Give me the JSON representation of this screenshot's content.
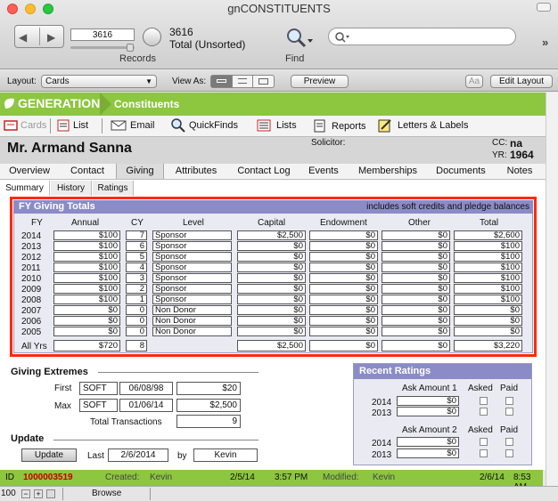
{
  "window": {
    "title": "gnCONSTITUENTS"
  },
  "toolbar": {
    "record_value": "3616",
    "found_count": "3616",
    "total_label": "Total (Unsorted)",
    "records_label": "Records",
    "find_label": "Find"
  },
  "layoutbar": {
    "layout_label": "Layout:",
    "layout_value": "Cards",
    "viewas_label": "View As:",
    "preview_label": "Preview",
    "aa_label": "Aa",
    "edit_layout_label": "Edit Layout"
  },
  "brand": {
    "name": "GENERATIONS",
    "section": "Constituents"
  },
  "nav": {
    "items": [
      "Cards",
      "List",
      "Email",
      "QuickFinds",
      "Lists",
      "Reports",
      "Letters & Labels"
    ]
  },
  "header": {
    "name": "Mr. Armand Sanna",
    "solicitor_label": "Solicitor:",
    "cc_label": "CC:",
    "cc_value": "na",
    "yr_label": "YR:",
    "yr_value": "1964"
  },
  "tabs": [
    "Overview",
    "Contact",
    "Giving",
    "Attributes",
    "Contact Log",
    "Events",
    "Memberships",
    "Documents",
    "Notes"
  ],
  "subtabs": [
    "Summary",
    "History",
    "Ratings"
  ],
  "fy": {
    "title": "FY Giving Totals",
    "note": "includes soft credits and pledge balances",
    "columns": [
      "FY",
      "Annual",
      "CY",
      "Level",
      "Capital",
      "Endowment",
      "Other",
      "Total"
    ],
    "rows": [
      {
        "fy": "2014",
        "annual": "$100",
        "cy": "7",
        "level": "Sponsor",
        "capital": "$2,500",
        "endowment": "$0",
        "other": "$0",
        "total": "$2,600"
      },
      {
        "fy": "2013",
        "annual": "$100",
        "cy": "6",
        "level": "Sponsor",
        "capital": "$0",
        "endowment": "$0",
        "other": "$0",
        "total": "$100"
      },
      {
        "fy": "2012",
        "annual": "$100",
        "cy": "5",
        "level": "Sponsor",
        "capital": "$0",
        "endowment": "$0",
        "other": "$0",
        "total": "$100"
      },
      {
        "fy": "2011",
        "annual": "$100",
        "cy": "4",
        "level": "Sponsor",
        "capital": "$0",
        "endowment": "$0",
        "other": "$0",
        "total": "$100"
      },
      {
        "fy": "2010",
        "annual": "$100",
        "cy": "3",
        "level": "Sponsor",
        "capital": "$0",
        "endowment": "$0",
        "other": "$0",
        "total": "$100"
      },
      {
        "fy": "2009",
        "annual": "$100",
        "cy": "2",
        "level": "Sponsor",
        "capital": "$0",
        "endowment": "$0",
        "other": "$0",
        "total": "$100"
      },
      {
        "fy": "2008",
        "annual": "$100",
        "cy": "1",
        "level": "Sponsor",
        "capital": "$0",
        "endowment": "$0",
        "other": "$0",
        "total": "$100"
      },
      {
        "fy": "2007",
        "annual": "$0",
        "cy": "0",
        "level": "Non Donor",
        "capital": "$0",
        "endowment": "$0",
        "other": "$0",
        "total": "$0"
      },
      {
        "fy": "2006",
        "annual": "$0",
        "cy": "0",
        "level": "Non Donor",
        "capital": "$0",
        "endowment": "$0",
        "other": "$0",
        "total": "$0"
      },
      {
        "fy": "2005",
        "annual": "$0",
        "cy": "0",
        "level": "Non Donor",
        "capital": "$0",
        "endowment": "$0",
        "other": "$0",
        "total": "$0"
      }
    ],
    "allyrs": {
      "label": "All Yrs",
      "annual": "$720",
      "cy": "8",
      "capital": "$2,500",
      "endowment": "$0",
      "other": "$0",
      "total": "$3,220"
    }
  },
  "extremes": {
    "title": "Giving Extremes",
    "first_label": "First",
    "first_type": "SOFT",
    "first_date": "06/08/98",
    "first_amount": "$20",
    "max_label": "Max",
    "max_type": "SOFT",
    "max_date": "01/06/14",
    "max_amount": "$2,500",
    "total_label": "Total Transactions",
    "total_value": "9"
  },
  "update": {
    "title": "Update",
    "button": "Update",
    "last_label": "Last",
    "last_date": "2/6/2014",
    "by_label": "by",
    "by_value": "Kevin"
  },
  "ratings": {
    "title": "Recent Ratings",
    "ask1_label": "Ask Amount 1",
    "ask2_label": "Ask Amount 2",
    "asked_label": "Asked",
    "paid_label": "Paid",
    "years": [
      "2014",
      "2013"
    ],
    "ask1": [
      "$0",
      "$0"
    ],
    "ask2": [
      "$0",
      "$0"
    ]
  },
  "status": {
    "id_label": "ID",
    "id_value": "1000003519",
    "created_label": "Created:",
    "created_by": "Kevin",
    "created_date": "2/5/14",
    "created_time": "3:57 PM",
    "modified_label": "Modified:",
    "modified_by": "Kevin",
    "modified_date": "2/6/14",
    "modified_time": "8:53 AM"
  },
  "bottom": {
    "zoom": "100",
    "mode": "Browse"
  },
  "colors": {
    "accent_green": "#8dc63f",
    "highlight_red": "#ff2a0a",
    "panel_header": "#8b8bc8",
    "id_red": "#c00000"
  }
}
